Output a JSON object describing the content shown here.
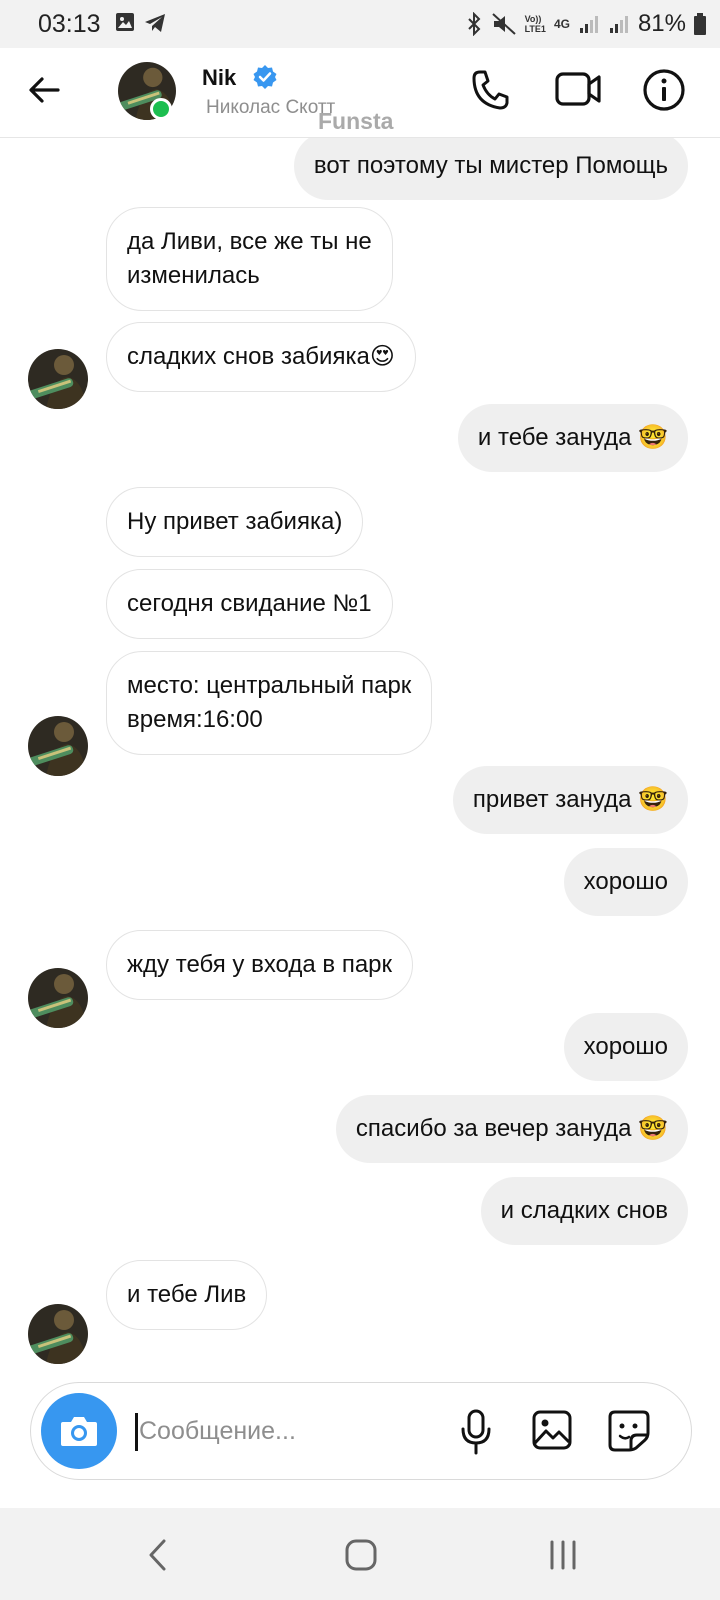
{
  "status_bar": {
    "time": "03:13",
    "battery_percent": "81%",
    "network_label": "4G",
    "volte_label": "Vo))",
    "lte_label": "LTE1"
  },
  "header": {
    "name": "Nik",
    "subtitle": "Николас Скотт",
    "verified": true,
    "online": true,
    "watermark": "Funsta"
  },
  "messages": [
    {
      "side": "out",
      "text": "вот поэтому ты мистер Помощь"
    },
    {
      "side": "in",
      "text": "да Ливи, все же ты не\nизменилась"
    },
    {
      "side": "in",
      "text": "сладких снов забияка😍"
    },
    {
      "side": "out",
      "text": "и тебе зануда 🤓"
    },
    {
      "side": "in",
      "text": "Ну привет забияка)"
    },
    {
      "side": "in",
      "text": "сегодня свидание №1"
    },
    {
      "side": "in",
      "text": "место: центральный парк\nвремя:16:00"
    },
    {
      "side": "out",
      "text": "привет зануда 🤓"
    },
    {
      "side": "out",
      "text": "хорошо"
    },
    {
      "side": "in",
      "text": "жду тебя у входа в парк"
    },
    {
      "side": "out",
      "text": "хорошо"
    },
    {
      "side": "out",
      "text": "спасибо за вечер  зануда 🤓"
    },
    {
      "side": "out",
      "text": "и сладких снов"
    },
    {
      "side": "in",
      "text": "и тебе Лив"
    }
  ],
  "composer": {
    "placeholder": "Сообщение...",
    "value": ""
  },
  "colors": {
    "accent": "#3797f0",
    "online": "#1cbe4f",
    "outgoing_bubble": "#efefef",
    "incoming_border": "#e3e3e3"
  },
  "icons": [
    "back-arrow-icon",
    "verified-badge-icon",
    "phone-icon",
    "video-camera-icon",
    "info-icon",
    "camera-icon",
    "microphone-icon",
    "gallery-icon",
    "sticker-icon",
    "nav-back-icon",
    "nav-home-icon",
    "nav-recents-icon"
  ]
}
